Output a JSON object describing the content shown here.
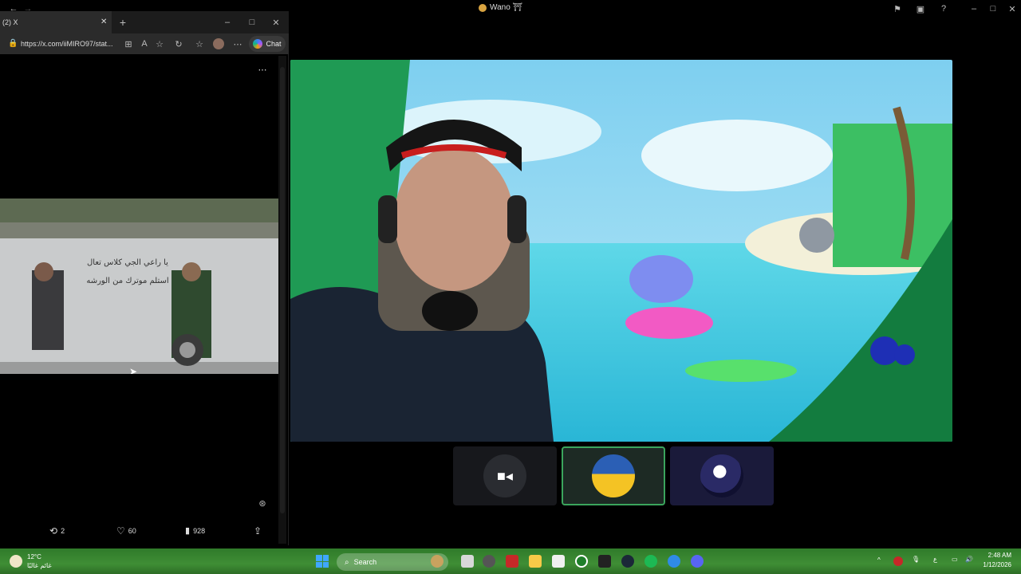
{
  "window": {
    "title": "Wano ⛩"
  },
  "browser": {
    "tab_title": "(2) X",
    "url": "https://x.com/iiMIRO97/stat...",
    "chat_label": "Chat",
    "media_text_line1": "يا راعي الجي كلاس تعال",
    "media_text_line2": "استلم موترك من الورشه",
    "stats": {
      "retweets": "2",
      "likes": "60",
      "views": "928"
    }
  },
  "taskbar": {
    "weather_temp": "12°C",
    "weather_desc": "غائم غالبًا",
    "search_placeholder": "Search",
    "time": "2:48 AM",
    "date": "1/12/2026"
  },
  "colors": {
    "stage_sky": "#8fd6ef",
    "stage_water": "#38c8df",
    "tile_selected_border": "#3ba55c",
    "taskbar_green": "#3f8e35"
  }
}
